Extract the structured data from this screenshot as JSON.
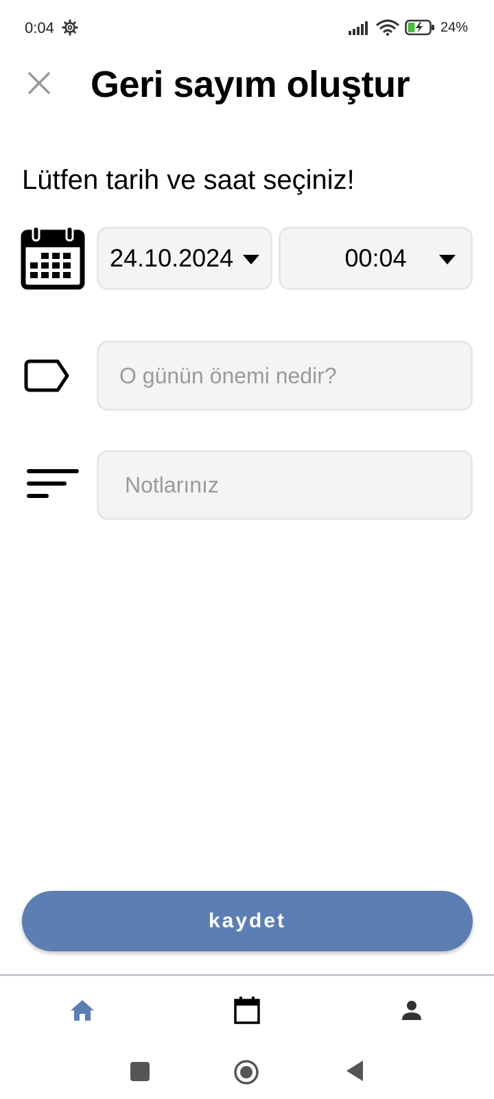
{
  "status_bar": {
    "time": "0:04",
    "battery_percent": "24%"
  },
  "header": {
    "title": "Geri sayım oluştur"
  },
  "form": {
    "prompt": "Lütfen tarih ve saat seçiniz!",
    "date_value": "24.10.2024",
    "time_value": "00:04",
    "importance_placeholder": "O günün önemi nedir?",
    "importance_value": "",
    "notes_placeholder": "Notlarınız",
    "notes_value": ""
  },
  "actions": {
    "save_label": "kaydet"
  },
  "colors": {
    "accent": "#5d7eb2",
    "field_bg": "#f4f4f4",
    "field_border": "#e6e6e6",
    "placeholder": "#9a9a9a",
    "nav_active": "#5d7eb2",
    "nav_divider": "#c5cad6"
  },
  "icons": {
    "close": "close-icon",
    "calendar": "calendar-icon",
    "tag": "tag-icon",
    "notes": "notes-icon",
    "nav_home": "home-icon",
    "nav_calendar": "calendar-outline-icon",
    "nav_profile": "person-icon"
  },
  "bottom_nav": {
    "active_tab": "home"
  }
}
